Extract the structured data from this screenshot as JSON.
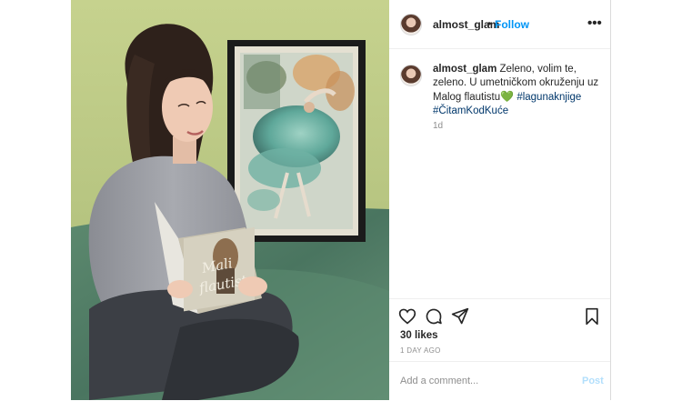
{
  "header": {
    "username": "almost_glam",
    "separator": "•",
    "follow_label": "Follow",
    "more_label": "•••"
  },
  "caption": {
    "username": "almost_glam",
    "text": "Zeleno, volim te, zeleno. U umetničkom okruženju uz Malog flautistu",
    "emoji": "💚",
    "hashtags": [
      "#lagunaknjige",
      "#ČitamKodKuće"
    ],
    "age": "1d"
  },
  "actions": {
    "likes": "30 likes",
    "date": "1 DAY AGO",
    "icons": [
      "heart-icon",
      "comment-icon",
      "share-icon",
      "bookmark-icon"
    ]
  },
  "comment_box": {
    "placeholder": "Add a comment...",
    "post_label": "Post"
  },
  "book": {
    "title_line1": "Mali",
    "title_line2": "flautist"
  },
  "colors": {
    "accent": "#0095f6",
    "post_disabled": "#b2dffc",
    "hashtag": "#00376b",
    "wall": "#b6c67d",
    "blanket": "#4f7a62"
  }
}
